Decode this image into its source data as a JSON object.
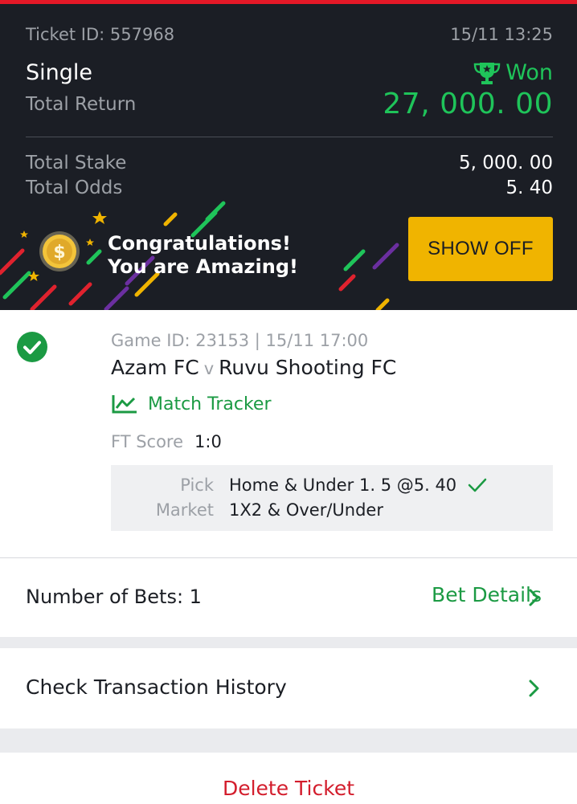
{
  "colors": {
    "accent_red": "#e41827",
    "won_green": "#1fc45a",
    "link_green": "#1b9a43",
    "header_bg": "#1b1e25",
    "showoff_yellow": "#f0b400",
    "delete_red": "#d31d2c"
  },
  "ticket": {
    "id_text": "Ticket ID: 557968",
    "date": "15/11 13:25",
    "type": "Single",
    "status": "Won",
    "status_icon": "trophy-icon",
    "total_return_label": "Total Return",
    "total_return": "27, 000. 00",
    "total_stake_label": "Total Stake",
    "total_stake": "5, 000. 00",
    "total_odds_label": "Total Odds",
    "total_odds": "5. 40"
  },
  "promo": {
    "line1": "Congratulations!",
    "line2": "You are Amazing!",
    "button": "SHOW OFF",
    "icon": "dollar-coin-icon"
  },
  "game": {
    "meta": "Game ID: 23153 | 15/11 17:00",
    "home": "Azam FC",
    "vs": "v",
    "away": "Ruvu Shooting FC",
    "tracker_label": "Match Tracker",
    "score_label": "FT Score",
    "score": "1:0",
    "pick_label": "Pick",
    "pick": "Home & Under 1. 5 @5. 40",
    "market_label": "Market",
    "market": "1X2 & Over/Under"
  },
  "bets": {
    "label": "Number of Bets: 1",
    "link": "Bet Details"
  },
  "history": {
    "label": "Check Transaction History"
  },
  "delete": {
    "label": "Delete Ticket"
  }
}
